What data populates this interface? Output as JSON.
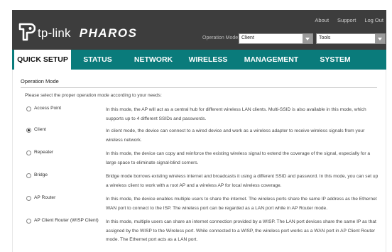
{
  "header": {
    "brand": "tp-link",
    "product": "PHAROS",
    "top_links": [
      "About",
      "Support",
      "Log Out"
    ],
    "operation_mode_label": "Operation Mode:",
    "operation_mode_value": "Client",
    "tools_value": "Tools"
  },
  "nav": {
    "items": [
      "QUICK SETUP",
      "STATUS",
      "NETWORK",
      "WIRELESS",
      "MANAGEMENT",
      "SYSTEM"
    ],
    "active": "QUICK SETUP"
  },
  "content": {
    "section_title": "Operation Mode",
    "intro": "Please select the proper operation mode according to your needs:",
    "options": [
      {
        "label": "Access Point",
        "checked": false,
        "desc": "In this mode, the AP will act as a central hub for different wireless LAN clients. Multi-SSID is also available in this mode, which supports up to 4 different SSIDs and passwords."
      },
      {
        "label": "Client",
        "checked": true,
        "desc": "In client mode, the device can connect to a wired device and work as a wireless adapter to receive wireless signals from your wireless network."
      },
      {
        "label": "Repeater",
        "checked": false,
        "desc": "In this mode, the device can copy and reinforce the existing wireless signal to extend the coverage of the signal, especially for a large space to eliminate signal-blind corners."
      },
      {
        "label": "Bridge",
        "checked": false,
        "desc": "Bridge mode borrows existing wireless internet and broadcasts it using a different SSID and password. In this mode, you can set up a wireless client to work with a root AP and a wireless AP for local wireless coverage."
      },
      {
        "label": "AP Router",
        "checked": false,
        "desc": "In this mode, the device enables multiple users to share the internet. The wireless ports share the same IP address as the Ethernet WAN port to connect to the ISP. The wireless port can be regarded as a LAN port while in AP Router mode."
      },
      {
        "label": "AP Client Router (WISP Client)",
        "checked": false,
        "desc": "In this mode, multiple users can share an internet connection provided by a WISP. The LAN port devices share the same IP as that assigned by the WISP to the Wireless port. While connected to a WISP, the wireless port works as a WAN port in AP Client Router mode. The Ethernet port acts as a LAN port."
      }
    ]
  }
}
